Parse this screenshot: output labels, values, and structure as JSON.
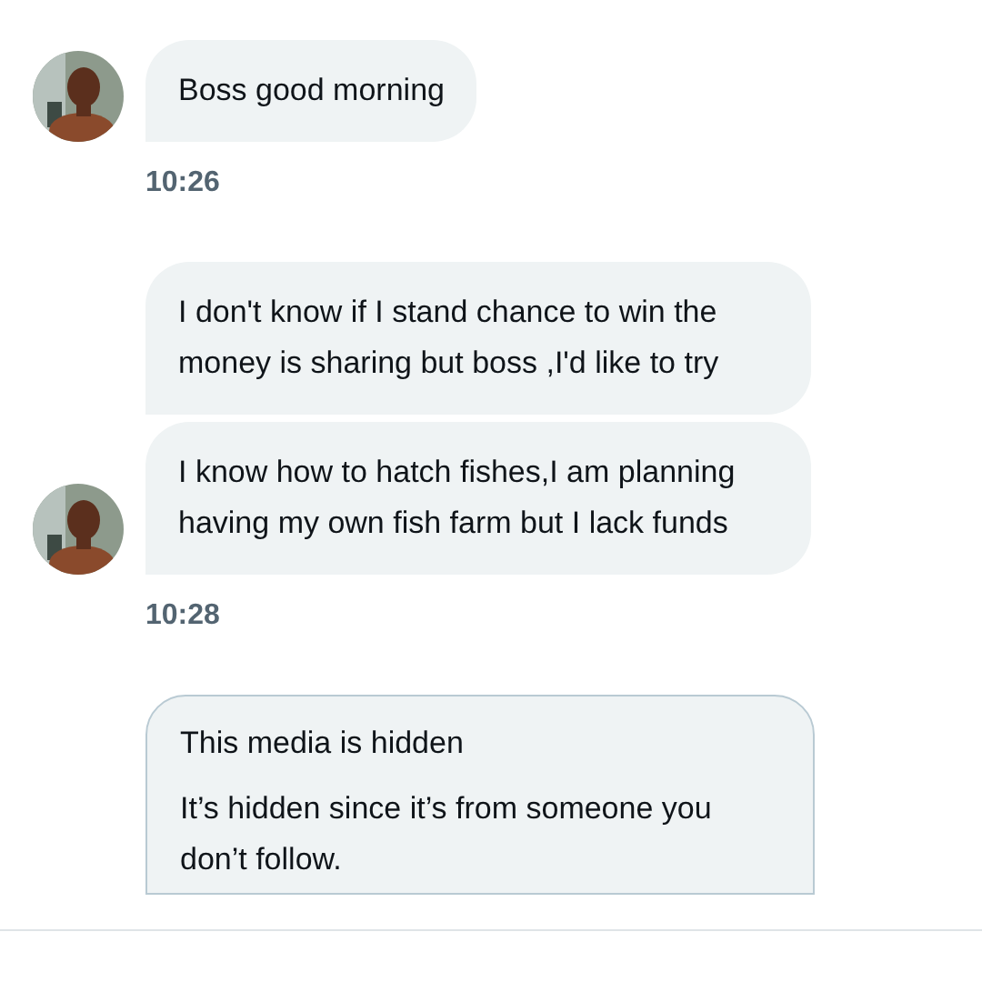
{
  "groups": [
    {
      "messages": [
        {
          "kind": "text",
          "text": "Boss good morning"
        }
      ],
      "time": "10:26"
    },
    {
      "messages": [
        {
          "kind": "text",
          "text": "I don't know if I stand chance to win the money is sharing but boss ,I'd like to try"
        },
        {
          "kind": "text",
          "text": "I know how to hatch fishes,I am planning having my own fish farm but I lack funds"
        }
      ],
      "time": "10:28"
    },
    {
      "messages": [
        {
          "kind": "media_hidden",
          "title": "This media is hidden",
          "text": "It’s hidden since it’s from someone you don’t follow."
        }
      ]
    }
  ]
}
